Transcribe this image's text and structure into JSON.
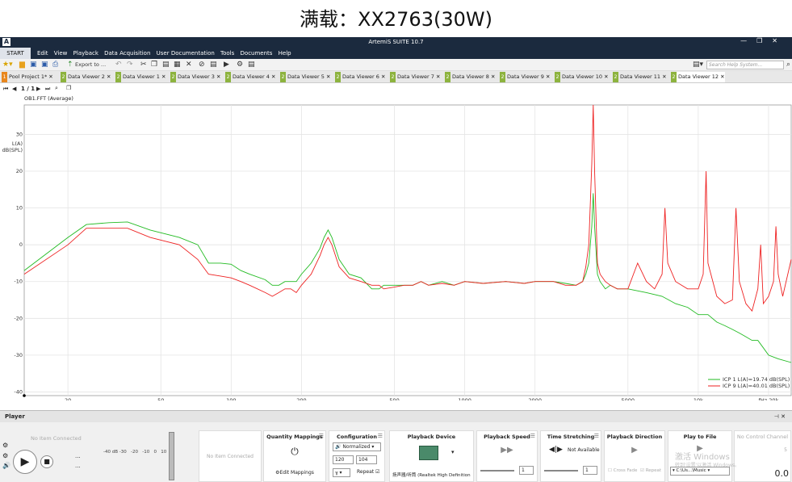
{
  "page_title": "满载：XX2763(30W)",
  "app": {
    "title": "ArtemiS SUITE 10.7",
    "logo": "A",
    "min_icon": "—",
    "max_icon": "❐",
    "close_icon": "✕"
  },
  "menu": {
    "start": "START",
    "items": [
      "Edit",
      "View",
      "Playback",
      "Data Acquisition",
      "User Documentation",
      "Tools",
      "Documents",
      "Help"
    ]
  },
  "toolbar": {
    "export_label": "Export to ...",
    "search_placeholder": "Search Help System..."
  },
  "tabs": [
    {
      "num": "1",
      "label": "Pool Project 1*",
      "orange": true
    },
    {
      "num": "2",
      "label": "Data Viewer 2"
    },
    {
      "num": "2",
      "label": "Data Viewer 1"
    },
    {
      "num": "2",
      "label": "Data Viewer 3"
    },
    {
      "num": "2",
      "label": "Data Viewer 4"
    },
    {
      "num": "2",
      "label": "Data Viewer 5"
    },
    {
      "num": "2",
      "label": "Data Viewer 6"
    },
    {
      "num": "2",
      "label": "Data Viewer 7"
    },
    {
      "num": "2",
      "label": "Data Viewer 8"
    },
    {
      "num": "2",
      "label": "Data Viewer 9"
    },
    {
      "num": "2",
      "label": "Data Viewer 10"
    },
    {
      "num": "2",
      "label": "Data Viewer 11"
    },
    {
      "num": "2",
      "label": "Data Viewer 12",
      "active": true
    }
  ],
  "nav": {
    "page": "1 / 1"
  },
  "plot_label": "OB1.FFT (Average)",
  "chart_data": {
    "type": "line",
    "ylabel": "L(A) dB(SPL)",
    "xlabel": "Hz",
    "x_scale": "log",
    "xlim": [
      13,
      25000
    ],
    "ylim": [
      -41,
      38
    ],
    "x_ticks": [
      20,
      50,
      100,
      200,
      500,
      1000,
      2000,
      5000,
      10000,
      20000
    ],
    "x_tick_labels": [
      "20",
      "50",
      "100",
      "200",
      "500",
      "1000",
      "2000",
      "5000",
      "10k",
      "fHz 20k"
    ],
    "y_ticks": [
      30,
      20,
      10,
      0,
      -10,
      -20,
      -30,
      -40
    ],
    "grid": true,
    "legend_position": "bottom-right",
    "series": [
      {
        "name": "ICP 1 L(A)=19.74 dB(SPL)",
        "color": "#22bb22",
        "points": [
          [
            13,
            -7
          ],
          [
            20,
            2
          ],
          [
            24,
            5.5
          ],
          [
            30,
            6
          ],
          [
            36,
            6.2
          ],
          [
            45,
            4
          ],
          [
            60,
            2
          ],
          [
            72,
            0
          ],
          [
            80,
            -5
          ],
          [
            90,
            -5
          ],
          [
            100,
            -5.3
          ],
          [
            110,
            -7
          ],
          [
            120,
            -8
          ],
          [
            140,
            -9.5
          ],
          [
            150,
            -11
          ],
          [
            160,
            -11
          ],
          [
            170,
            -10
          ],
          [
            180,
            -10
          ],
          [
            190,
            -10
          ],
          [
            200,
            -8
          ],
          [
            220,
            -5
          ],
          [
            240,
            -1
          ],
          [
            250,
            2
          ],
          [
            260,
            4
          ],
          [
            270,
            2
          ],
          [
            290,
            -4
          ],
          [
            320,
            -8
          ],
          [
            360,
            -9
          ],
          [
            400,
            -12
          ],
          [
            430,
            -12
          ],
          [
            450,
            -11
          ],
          [
            500,
            -11
          ],
          [
            550,
            -11
          ],
          [
            600,
            -11
          ],
          [
            650,
            -10
          ],
          [
            700,
            -11
          ],
          [
            800,
            -10
          ],
          [
            900,
            -11
          ],
          [
            1000,
            -10
          ],
          [
            1200,
            -10.5
          ],
          [
            1500,
            -10
          ],
          [
            1800,
            -10.5
          ],
          [
            2000,
            -10
          ],
          [
            2400,
            -10
          ],
          [
            2700,
            -10.5
          ],
          [
            3000,
            -11
          ],
          [
            3200,
            -10
          ],
          [
            3300,
            -8
          ],
          [
            3400,
            -5
          ],
          [
            3500,
            5
          ],
          [
            3550,
            14
          ],
          [
            3600,
            5
          ],
          [
            3700,
            -8
          ],
          [
            3800,
            -10
          ],
          [
            4000,
            -12
          ],
          [
            4200,
            -11
          ],
          [
            4500,
            -12
          ],
          [
            5000,
            -12
          ],
          [
            6000,
            -13
          ],
          [
            7000,
            -14
          ],
          [
            8000,
            -16
          ],
          [
            9000,
            -17
          ],
          [
            10000,
            -19
          ],
          [
            11000,
            -19
          ],
          [
            12000,
            -21
          ],
          [
            13000,
            -22
          ],
          [
            14000,
            -23
          ],
          [
            15000,
            -24
          ],
          [
            16000,
            -25
          ],
          [
            17000,
            -26
          ],
          [
            18000,
            -26
          ],
          [
            19000,
            -28
          ],
          [
            20000,
            -30
          ],
          [
            22000,
            -31
          ],
          [
            25000,
            -32
          ]
        ]
      },
      {
        "name": "ICP 9 L(A)=40.01 dB(SPL)",
        "color": "#ee2222",
        "points": [
          [
            13,
            -8
          ],
          [
            20,
            0
          ],
          [
            24,
            4.5
          ],
          [
            30,
            4.5
          ],
          [
            36,
            4.5
          ],
          [
            45,
            2
          ],
          [
            60,
            0
          ],
          [
            72,
            -4
          ],
          [
            80,
            -8
          ],
          [
            90,
            -8.5
          ],
          [
            100,
            -9
          ],
          [
            110,
            -10
          ],
          [
            120,
            -11
          ],
          [
            140,
            -13
          ],
          [
            150,
            -14
          ],
          [
            160,
            -13
          ],
          [
            170,
            -12
          ],
          [
            180,
            -12
          ],
          [
            190,
            -13
          ],
          [
            200,
            -11
          ],
          [
            220,
            -8
          ],
          [
            240,
            -3
          ],
          [
            250,
            0
          ],
          [
            260,
            2
          ],
          [
            270,
            0
          ],
          [
            290,
            -6
          ],
          [
            320,
            -9
          ],
          [
            360,
            -10
          ],
          [
            400,
            -11
          ],
          [
            430,
            -11
          ],
          [
            450,
            -12
          ],
          [
            500,
            -11.5
          ],
          [
            550,
            -11
          ],
          [
            600,
            -11
          ],
          [
            650,
            -10
          ],
          [
            700,
            -11
          ],
          [
            800,
            -10.5
          ],
          [
            900,
            -11
          ],
          [
            1000,
            -10
          ],
          [
            1200,
            -10.5
          ],
          [
            1500,
            -10
          ],
          [
            1800,
            -10.5
          ],
          [
            2000,
            -10
          ],
          [
            2400,
            -10
          ],
          [
            2700,
            -11
          ],
          [
            3000,
            -11
          ],
          [
            3200,
            -10
          ],
          [
            3300,
            -6
          ],
          [
            3400,
            0
          ],
          [
            3500,
            22
          ],
          [
            3550,
            38
          ],
          [
            3600,
            20
          ],
          [
            3700,
            -5
          ],
          [
            3800,
            -8
          ],
          [
            4000,
            -10
          ],
          [
            4200,
            -11
          ],
          [
            4500,
            -12
          ],
          [
            5000,
            -12
          ],
          [
            5500,
            -5
          ],
          [
            6000,
            -10
          ],
          [
            6500,
            -12
          ],
          [
            7000,
            -8
          ],
          [
            7200,
            10
          ],
          [
            7400,
            -5
          ],
          [
            8000,
            -10
          ],
          [
            9000,
            -12
          ],
          [
            10000,
            -12
          ],
          [
            10500,
            -8
          ],
          [
            10800,
            20
          ],
          [
            11000,
            -5
          ],
          [
            12000,
            -14
          ],
          [
            13000,
            -16
          ],
          [
            14000,
            -15
          ],
          [
            14500,
            10
          ],
          [
            15000,
            -10
          ],
          [
            16000,
            -16
          ],
          [
            17000,
            -18
          ],
          [
            18000,
            -12
          ],
          [
            18500,
            0
          ],
          [
            19000,
            -16
          ],
          [
            20000,
            -14
          ],
          [
            21000,
            -10
          ],
          [
            21500,
            5
          ],
          [
            22000,
            -8
          ],
          [
            23000,
            -14
          ],
          [
            25000,
            -4
          ]
        ]
      }
    ]
  },
  "player": {
    "header": "Player",
    "no_item": "No Item Connected",
    "dashes": [
      "...",
      "..."
    ],
    "meter_ticks": [
      "-40",
      "dB",
      "-30",
      "-20",
      "-10",
      "0",
      "10"
    ],
    "no_item_2": "No Item Connected",
    "quantity_mappings": {
      "title": "Quantity Mappings",
      "edit": "Edit Mappings"
    },
    "configuration": {
      "title": "Configuration",
      "mode": "Normalized",
      "val1": "120",
      "val2": "104",
      "repeat": "Repeat"
    },
    "playback_device": {
      "title": "Playback Device",
      "device": "扬声器/听筒 (Realtek High Definition"
    },
    "playback_speed": {
      "title": "Playback Speed",
      "value": "1"
    },
    "time_stretching": {
      "title": "Time Stretching",
      "status": "Not Available",
      "value": "1"
    },
    "playback_direction": {
      "title": "Playback Direction",
      "cross_fade": "Cross Fade",
      "repeat": "Repeat"
    },
    "play_to_file": {
      "title": "Play to File",
      "path": "C:\\Us...\\Music"
    },
    "control_channel": {
      "title": "No Control Channel",
      "value": "0.0",
      "s": "5"
    },
    "watermark": [
      "激活 Windows",
      "转到'设置'以激活 Windows。"
    ]
  }
}
